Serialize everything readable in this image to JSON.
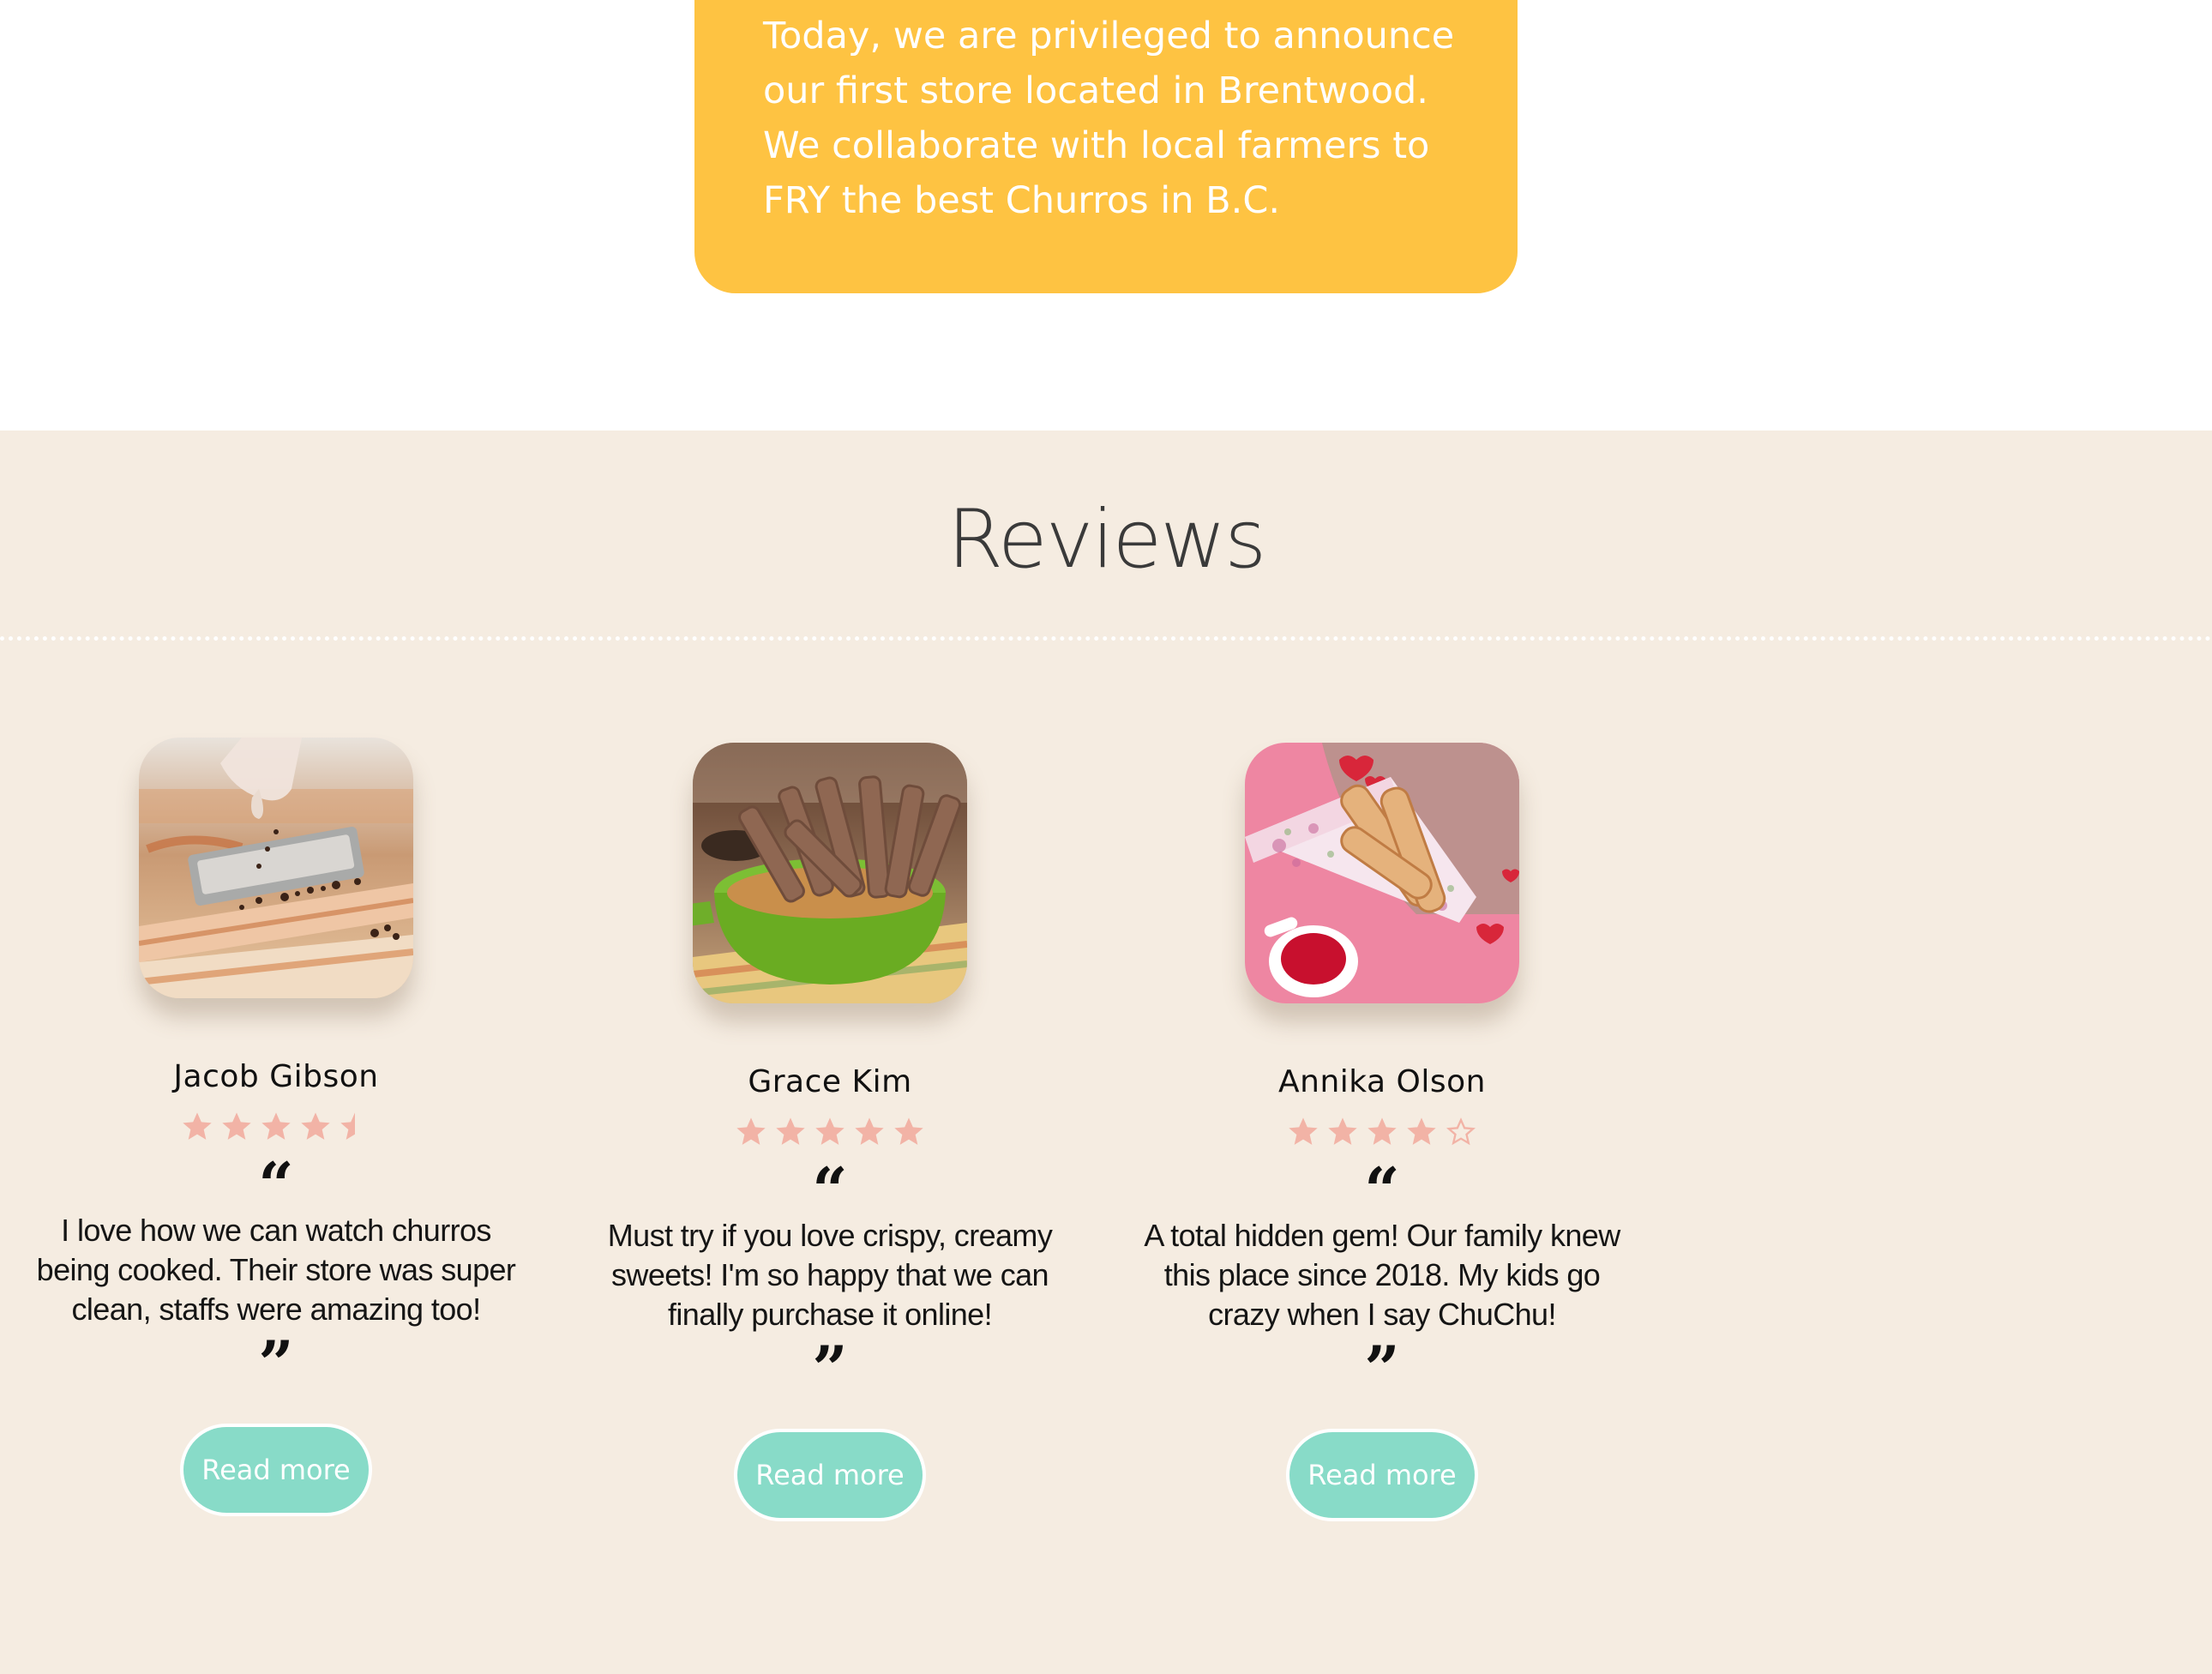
{
  "announcement": {
    "lines": [
      "Today, we are privileged to announce",
      "our first store located in Brentwood.",
      "We collaborate with local farmers to",
      "FRY the best Churros in B.C."
    ]
  },
  "reviews_section": {
    "title": "Reviews",
    "reviews": [
      {
        "name": "Jacob Gibson",
        "rating": 4.5,
        "text": "I love how we can watch churros being cooked. Their store was super clean, staffs were amazing too!",
        "button_label": "Read more"
      },
      {
        "name": "Grace Kim",
        "rating": 5,
        "text": "Must try if you love crispy, creamy sweets! I'm so happy that we can finally purchase it online!",
        "button_label": "Read more"
      },
      {
        "name": "Annika Olson",
        "rating": 4,
        "text": "A total hidden gem! Our family knew this place since 2018. My kids go crazy when I say ChuChu!",
        "button_label": "Read more"
      }
    ]
  },
  "colors": {
    "announcement_bg": "#fec342",
    "section_bg": "#f5ece1",
    "star": "#f2b3a6",
    "button": "#88dbc8"
  }
}
